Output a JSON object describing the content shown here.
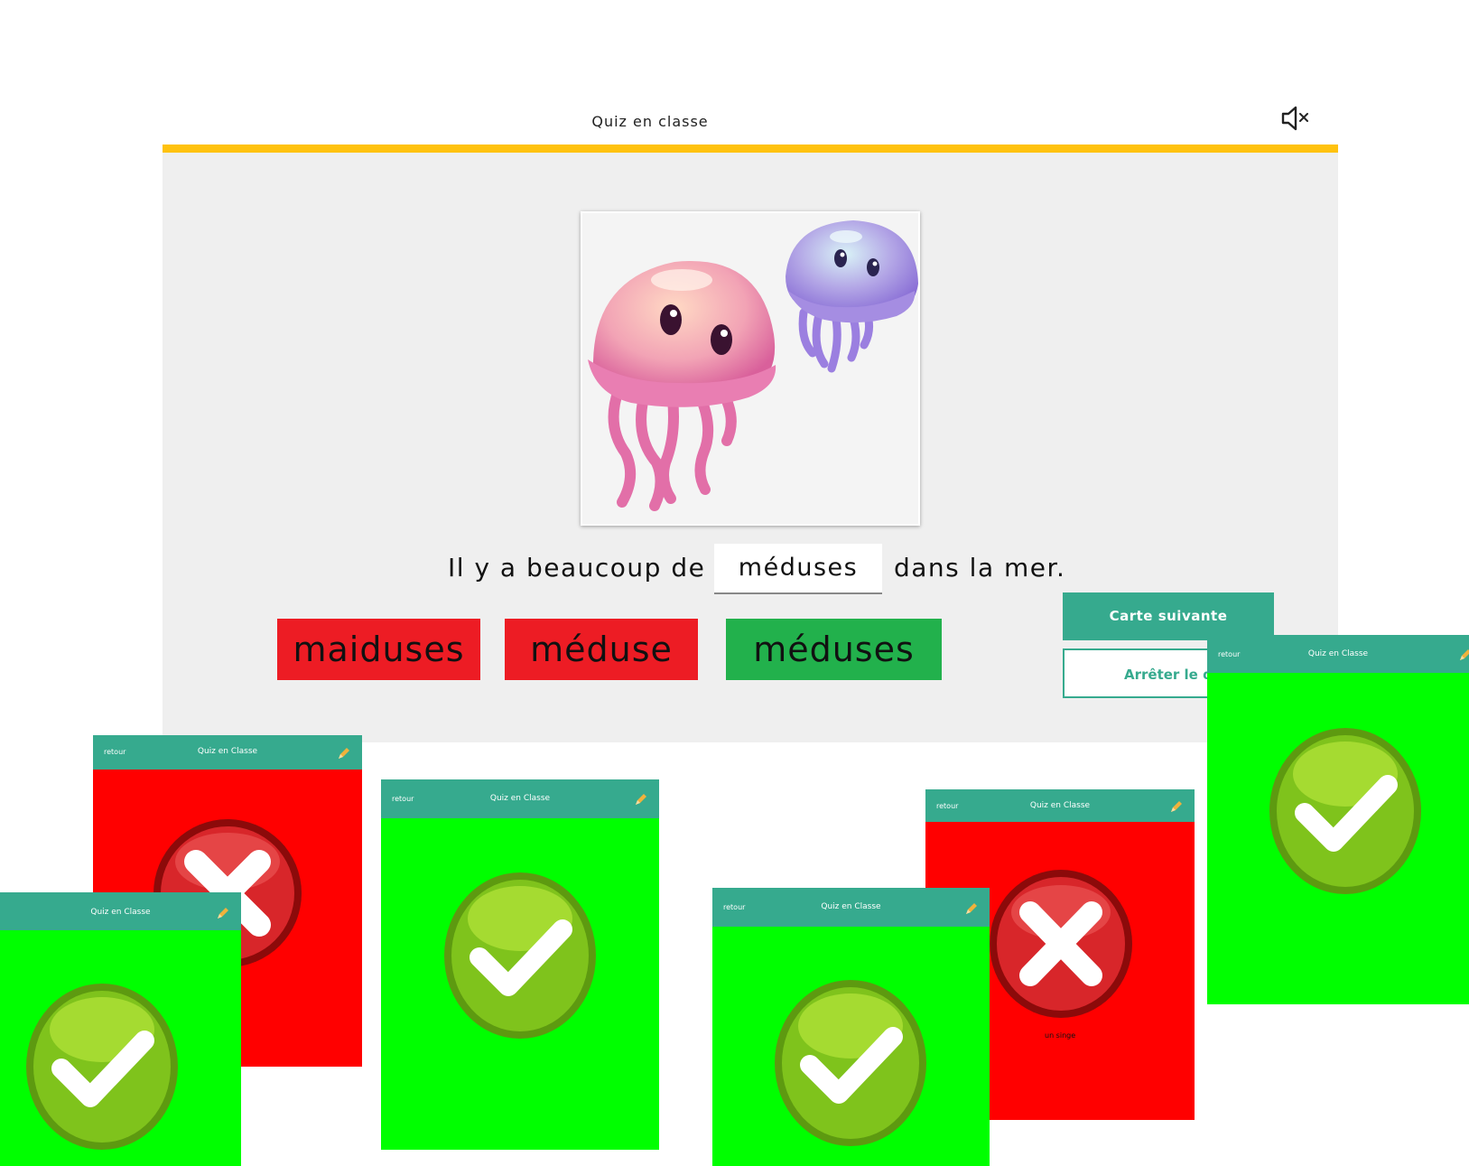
{
  "app": {
    "title": "Quiz en classe"
  },
  "icons": {
    "mute": "speaker-muted-icon",
    "edit": "pencil-icon",
    "correct": "check-icon",
    "wrong": "cross-icon",
    "picture": "jellyfish-image"
  },
  "colors": {
    "accent": "#36aa8e",
    "bar": "#ffc20e",
    "wrong": "#ed1c24",
    "right": "#22b14c",
    "card_green": "#00ff00",
    "card_red": "#ff0000"
  },
  "question": {
    "before": "Il y a beaucoup de",
    "answer": "méduses",
    "after": "dans la mer."
  },
  "choices": [
    {
      "label": "maiduses",
      "state": "wrong"
    },
    {
      "label": "méduse",
      "state": "wrong"
    },
    {
      "label": "méduses",
      "state": "correct"
    }
  ],
  "buttons": {
    "next": "Carte suivante",
    "stop": "Arrêter le qui"
  },
  "cards": {
    "title": "Quiz en Classe",
    "back": "retour",
    "caption": "un singe"
  }
}
